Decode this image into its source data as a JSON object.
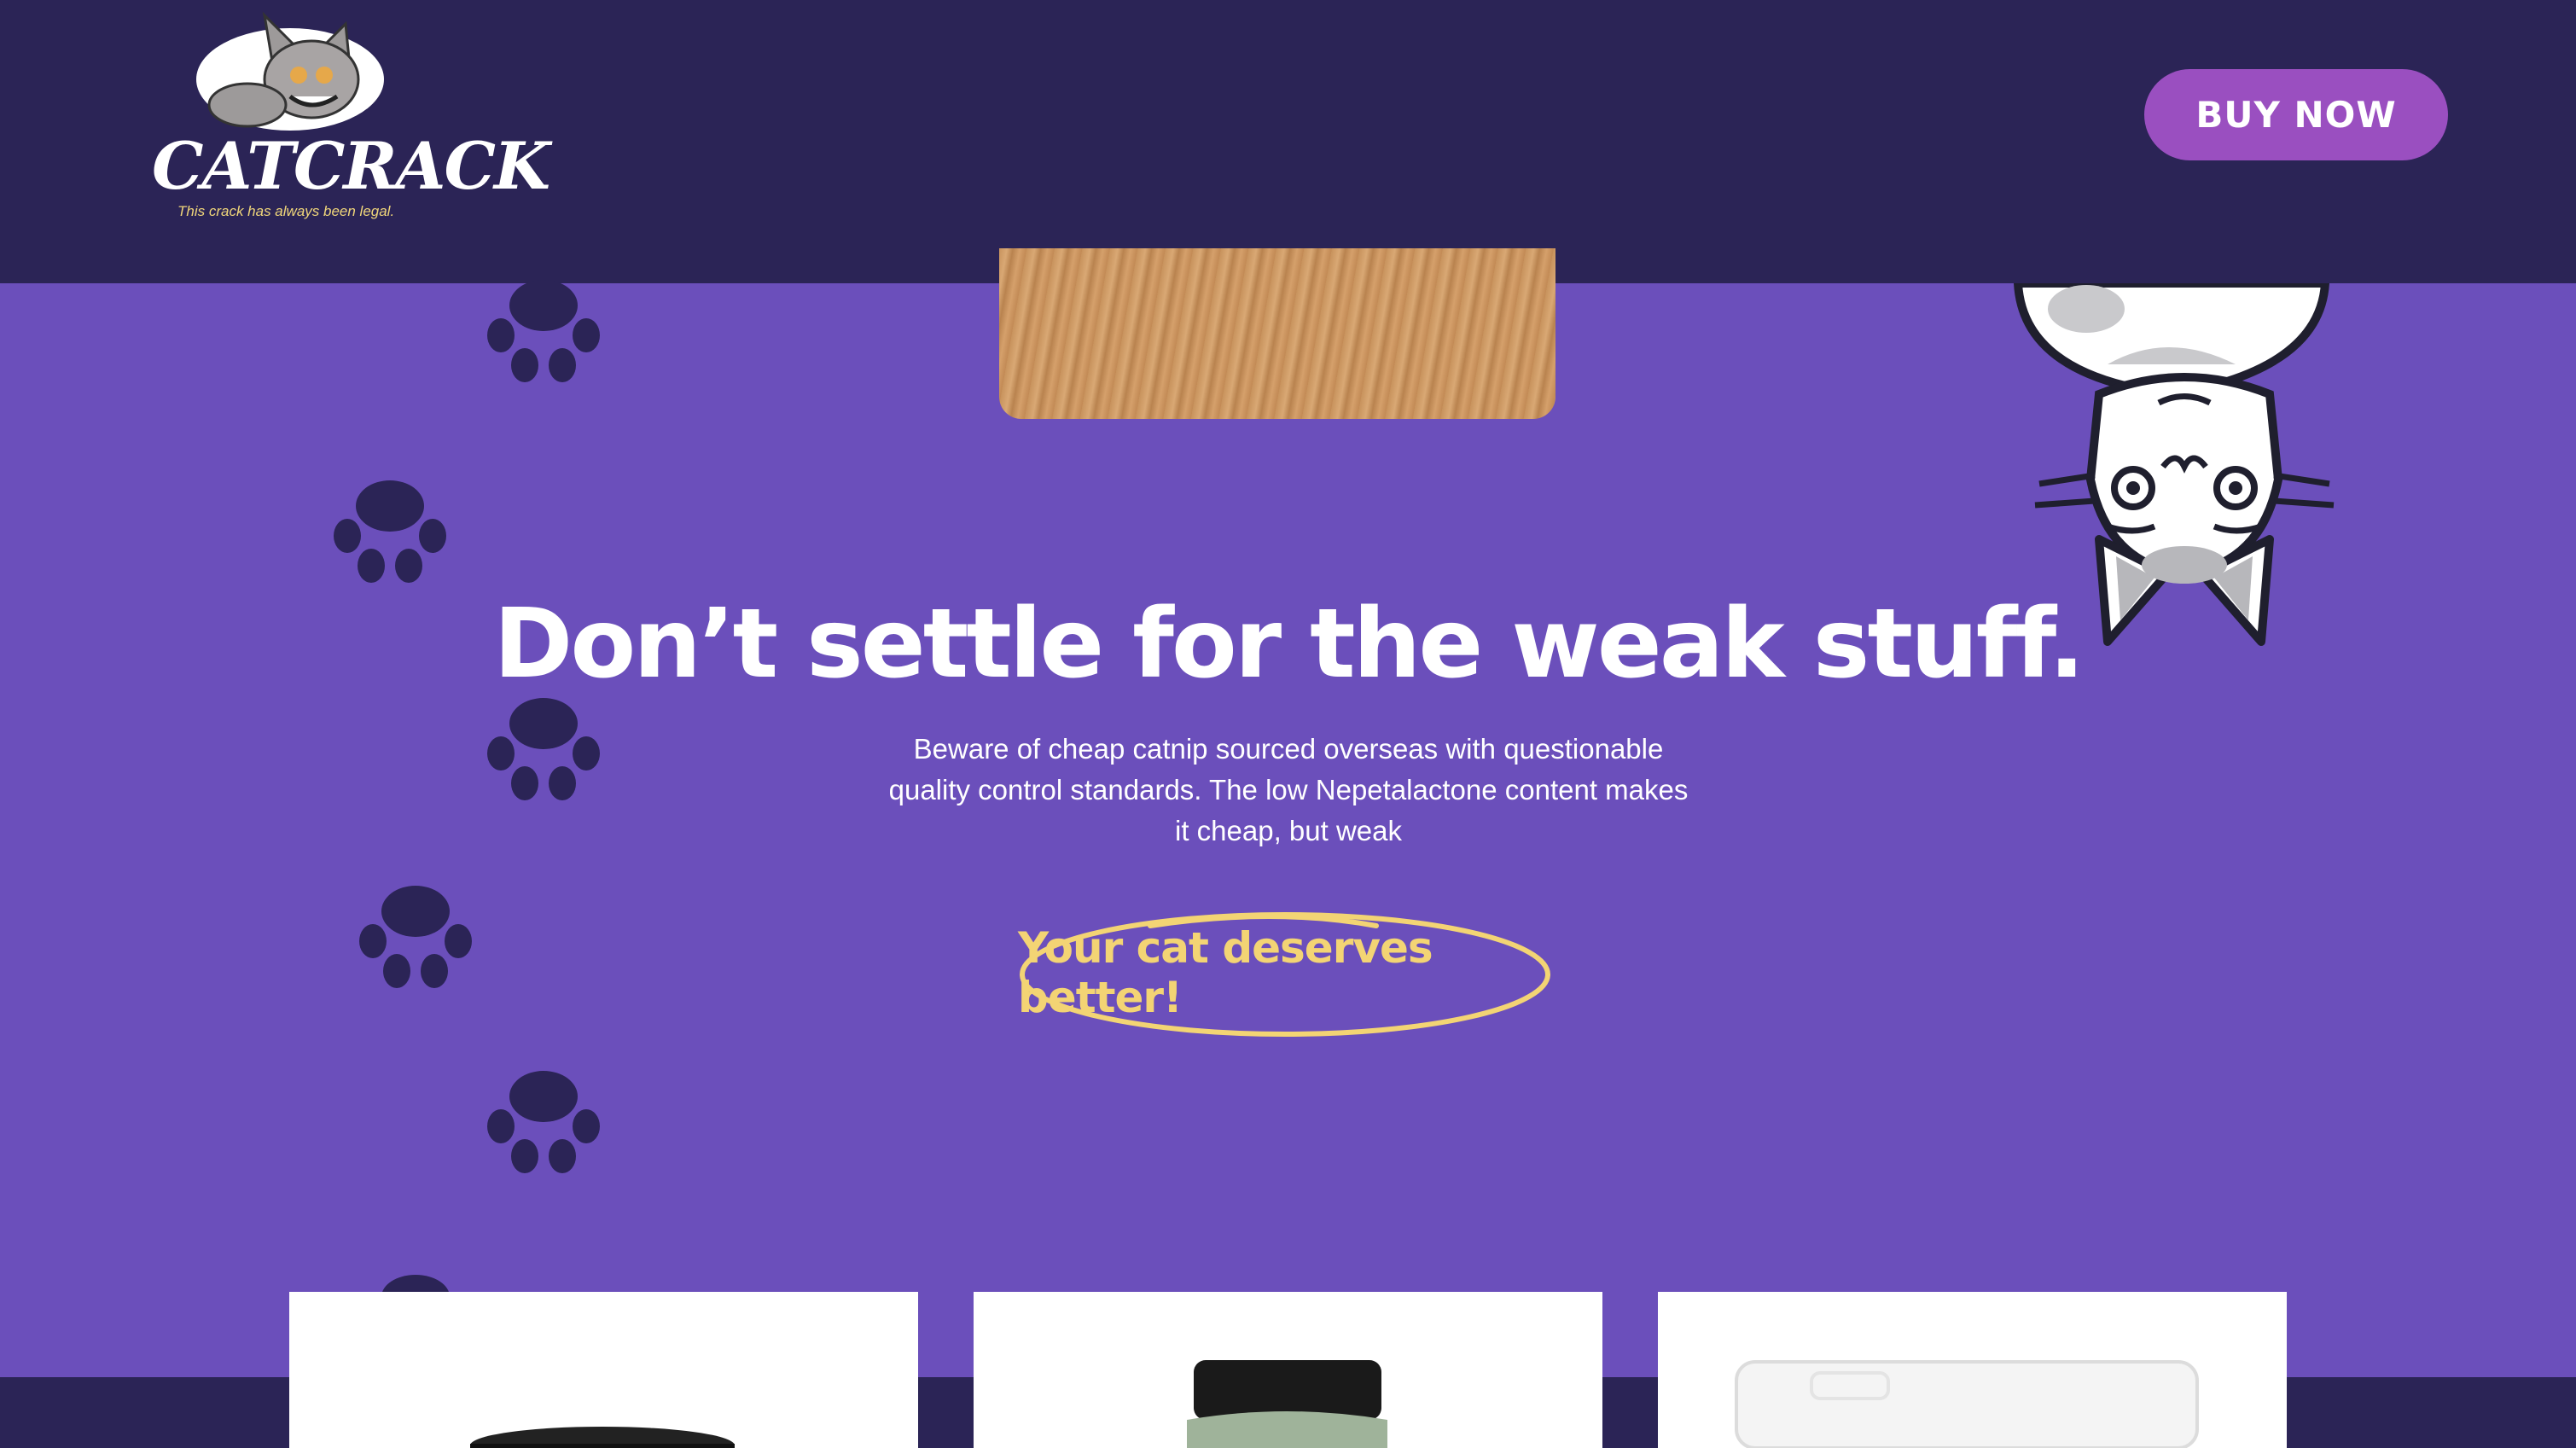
{
  "header": {
    "logo_text": "CATCRACK",
    "logo_tagline": "This crack has always been legal.",
    "buy_label": "BUY NOW"
  },
  "hero": {
    "headline": "Don’t settle for the weak stuff.",
    "body": "Beware of cheap catnip sourced overseas with questionable quality control standards. The low Nepetalactone content makes it cheap, but weak",
    "cta_label": "Your cat deserves better!"
  },
  "colors": {
    "header_bg": "#2b2456",
    "hero_bg": "#6b4fbb",
    "button_bg": "#9a4fc0",
    "cta_yellow": "#f3d474"
  },
  "products": [
    {
      "name": "product-card-1"
    },
    {
      "name": "product-card-2"
    },
    {
      "name": "product-card-3"
    }
  ]
}
